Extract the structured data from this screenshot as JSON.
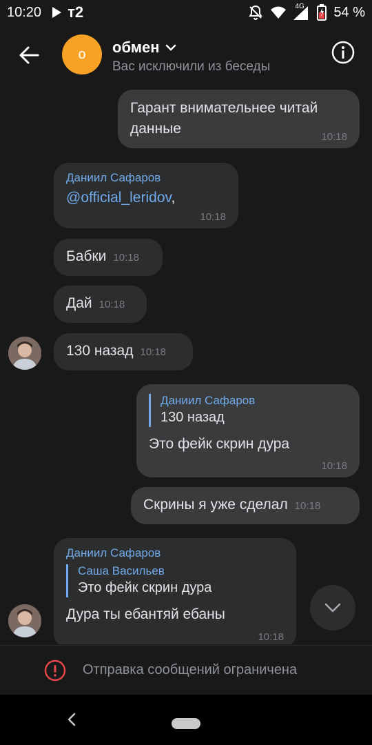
{
  "status": {
    "time": "10:20",
    "carrier": "т2",
    "network": "4G",
    "battery": "54 %"
  },
  "header": {
    "avatar_letter": "о",
    "title": "обмен",
    "subtitle": "Вас исключили из беседы"
  },
  "messages": [
    {
      "text": "Гарант внимательнее читай данные",
      "time": "10:18"
    },
    {
      "sender": "Даниил Сафаров",
      "mention": "@official_leridov",
      "tail": ",",
      "time": "10:18"
    },
    {
      "text": "Бабки",
      "time": "10:18"
    },
    {
      "text": "Дай",
      "time": "10:18"
    },
    {
      "text": "130 назад",
      "time": "10:18"
    },
    {
      "reply_name": "Даниил Сафаров",
      "reply_text": "130 назад",
      "text": "Это фейк скрин дура",
      "time": "10:18"
    },
    {
      "text": "Скрины я уже сделал",
      "time": "10:18"
    },
    {
      "sender": "Даниил Сафаров",
      "reply_name": "Саша Васильев",
      "reply_text": "Это фейк скрин дура",
      "text": "Дура ты ебантяй ебаны",
      "time": "10:18"
    }
  ],
  "restriction": {
    "text": "Отправка сообщений ограничена"
  },
  "colors": {
    "accent": "#71aaeb",
    "avatar_bg": "#f7a125",
    "warning": "#e64646",
    "background": "#19191a"
  }
}
